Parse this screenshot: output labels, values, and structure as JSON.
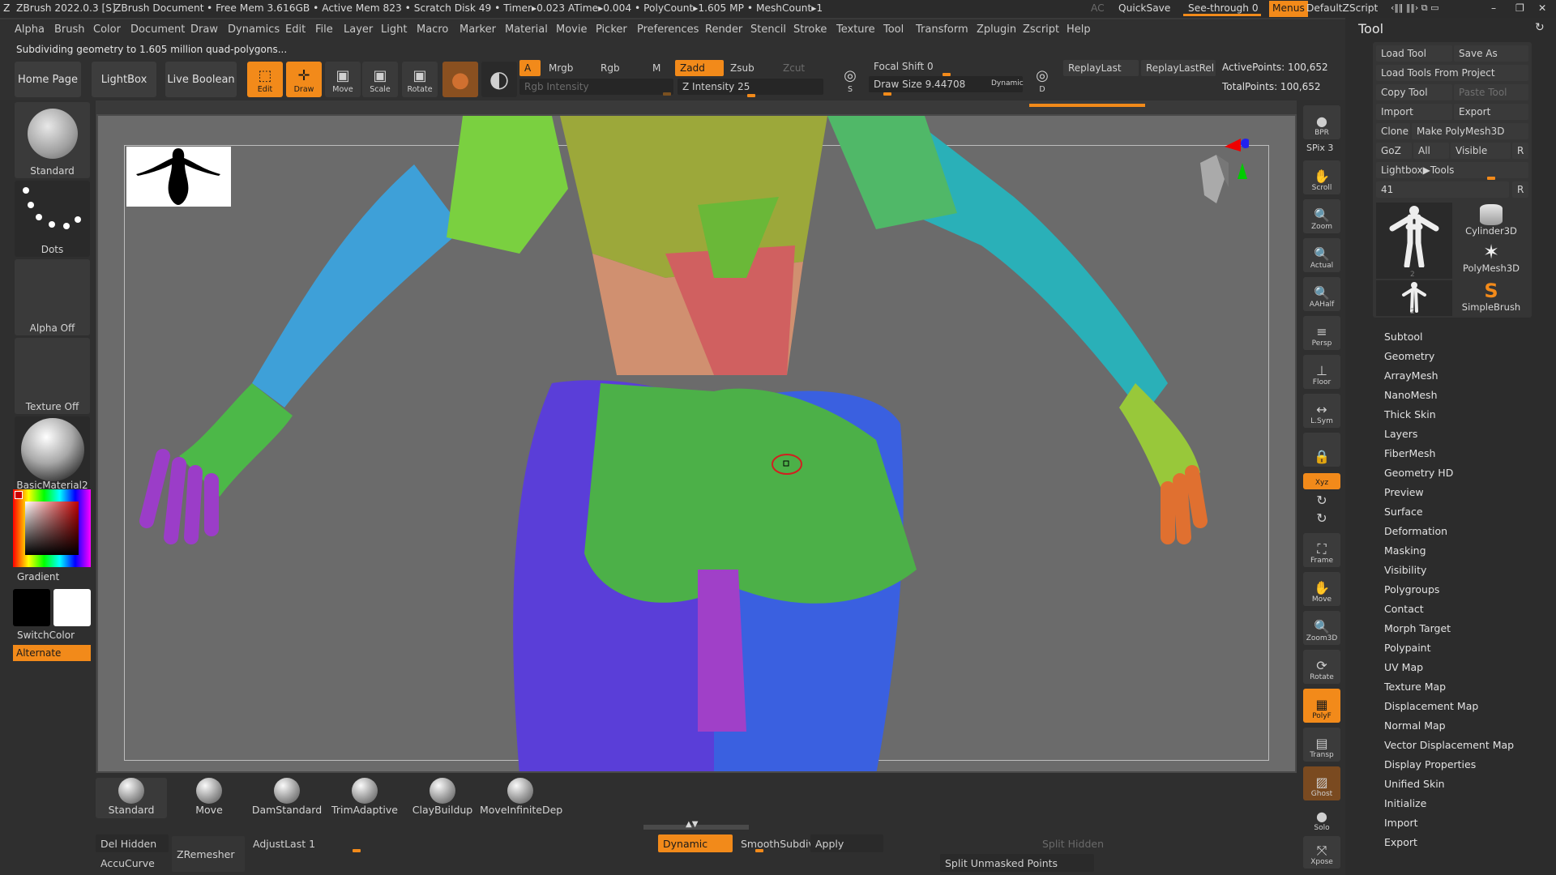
{
  "titlebar": {
    "app": "ZBrush 2022.0.3 [S]",
    "doc": "ZBrush Document",
    "stats": "• Free Mem 3.616GB • Active Mem 823 • Scratch Disk 49 •  Timer▸0.023 ATime▸0.004 • PolyCount▸1.605 MP  • MeshCount▸1",
    "ac": "AC",
    "quicksave": "QuickSave",
    "seethrough": "See-through  0",
    "menus": "Menus",
    "zscript": "DefaultZScript"
  },
  "menus": [
    "Alpha",
    "Brush",
    "Color",
    "Document",
    "Draw",
    "Dynamics",
    "Edit",
    "File",
    "Layer",
    "Light",
    "Macro",
    "Marker",
    "Material",
    "Movie",
    "Picker",
    "Preferences",
    "Render",
    "Stencil",
    "Stroke",
    "Texture",
    "Tool",
    "Transform",
    "Zplugin",
    "Zscript",
    "Help"
  ],
  "status": "Subdividing geometry to 1.605 million quad-polygons...",
  "toolbar": {
    "home": "Home Page",
    "lightbox": "LightBox",
    "liveboolean": "Live Boolean",
    "edit": "Edit",
    "draw": "Draw",
    "move": "Move",
    "scale": "Scale",
    "rotate": "Rotate",
    "a": "A",
    "mrgb": "Mrgb",
    "rgb": "Rgb",
    "m": "M",
    "rgb_intensity": "Rgb Intensity",
    "zadd": "Zadd",
    "zsub": "Zsub",
    "zcut": "Zcut",
    "z_intensity": "Z Intensity 25",
    "focal_shift": "Focal Shift 0",
    "draw_size": "Draw Size 9.44708",
    "dynamic": "Dynamic",
    "replay_last": "ReplayLast",
    "replay_last_rel": "ReplayLastRel",
    "active_points": "ActivePoints: 100,652",
    "total_points": "TotalPoints: 100,652",
    "s_label": "S",
    "d_label": "D"
  },
  "leftshelf": {
    "brush": "Standard",
    "stroke": "Dots",
    "alpha": "Alpha Off",
    "texture": "Texture Off",
    "material": "BasicMaterial2",
    "gradient": "Gradient",
    "switchcolor": "SwitchColor",
    "alternate": "Alternate"
  },
  "rightshelf": [
    "BPR",
    "SPix 3",
    "Scroll",
    "Zoom",
    "Actual",
    "AAHalf",
    "Persp",
    "Floor",
    "L.Sym",
    "",
    "Xyz",
    "",
    "",
    "Frame",
    "Move",
    "Zoom3D",
    "Rotate",
    "PolyF",
    "Transp",
    "Ghost",
    "Solo",
    "Xpose"
  ],
  "toolpanel": {
    "title": "Tool",
    "load_tool": "Load Tool",
    "save_as": "Save As",
    "load_from_project": "Load Tools From Project",
    "copy_tool": "Copy Tool",
    "paste_tool": "Paste Tool",
    "import": "Import",
    "export": "Export",
    "clone": "Clone",
    "make_polymesh": "Make PolyMesh3D",
    "goz": "GoZ",
    "all": "All",
    "visible": "Visible",
    "r": "R",
    "lightbox_tools": "Lightbox▶Tools",
    "count": "41",
    "thumb_count_1": "2",
    "thumb_count_2": "2",
    "thumbs": [
      "Cylinder3D",
      "PolyMesh3D",
      "SimpleBrush"
    ],
    "menu": [
      "Subtool",
      "Geometry",
      "ArrayMesh",
      "NanoMesh",
      "Thick Skin",
      "Layers",
      "FiberMesh",
      "Geometry HD",
      "Preview",
      "Surface",
      "Deformation",
      "Masking",
      "Visibility",
      "Polygroups",
      "Contact",
      "Morph Target",
      "Polypaint",
      "UV Map",
      "Texture Map",
      "Displacement Map",
      "Normal Map",
      "Vector Displacement Map",
      "Display Properties",
      "Unified Skin",
      "Initialize",
      "Import",
      "Export"
    ]
  },
  "bottom": {
    "brushes": [
      "Standard",
      "Move",
      "DamStandard",
      "TrimAdaptive",
      "ClayBuildup",
      "MoveInfiniteDep"
    ],
    "del_hidden": "Del Hidden",
    "accucurve": "AccuCurve",
    "zremesher": "ZRemesher",
    "adjust_last": "AdjustLast 1",
    "dynamic": "Dynamic",
    "smooth_subdiv": "SmoothSubdiv",
    "apply": "Apply",
    "split_hidden": "Split Hidden",
    "split_unmasked": "Split Unmasked Points"
  },
  "colors": {
    "accent": "#f28a1a",
    "panel": "#2f2f2f",
    "viewport": "#6b6b6b"
  }
}
